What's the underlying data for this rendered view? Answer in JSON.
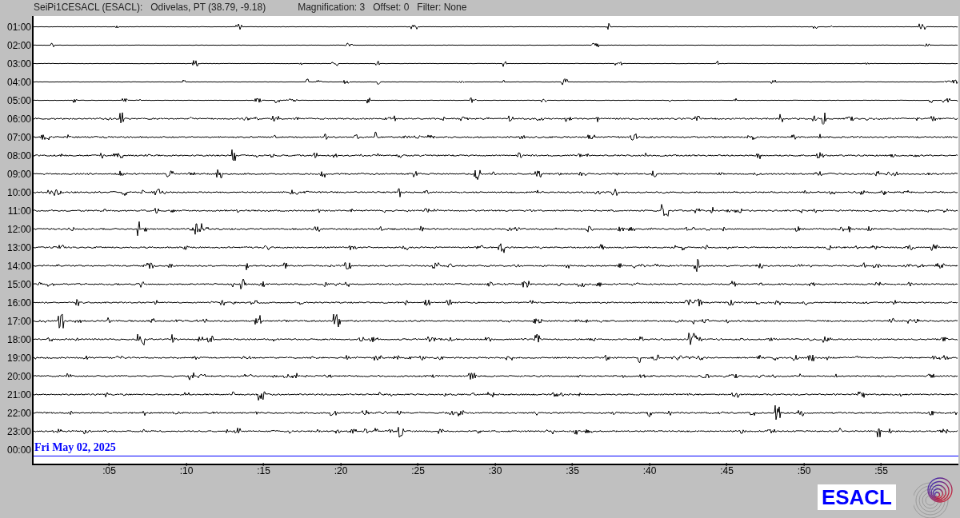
{
  "header": {
    "station": "SeiPi1CESACL (ESACL):",
    "location": "Odivelas, PT (38.79, -9.18)",
    "magnification": "Magnification: 3",
    "offset": "Offset: 0",
    "filter": "Filter: None"
  },
  "rows": [
    {
      "label": "01:00",
      "current": false
    },
    {
      "label": "02:00",
      "current": false
    },
    {
      "label": "03:00",
      "current": false
    },
    {
      "label": "04:00",
      "current": false
    },
    {
      "label": "05:00",
      "current": false
    },
    {
      "label": "06:00",
      "current": false
    },
    {
      "label": "07:00",
      "current": false
    },
    {
      "label": "08:00",
      "current": false
    },
    {
      "label": "09:00",
      "current": false
    },
    {
      "label": "10:00",
      "current": false
    },
    {
      "label": "11:00",
      "current": false
    },
    {
      "label": "12:00",
      "current": false
    },
    {
      "label": "13:00",
      "current": false
    },
    {
      "label": "14:00",
      "current": false
    },
    {
      "label": "15:00",
      "current": false
    },
    {
      "label": "16:00",
      "current": false
    },
    {
      "label": "17:00",
      "current": false
    },
    {
      "label": "18:00",
      "current": false
    },
    {
      "label": "19:00",
      "current": false
    },
    {
      "label": "20:00",
      "current": false
    },
    {
      "label": "21:00",
      "current": false
    },
    {
      "label": "22:00",
      "current": false
    },
    {
      "label": "23:00",
      "current": false
    },
    {
      "label": "00:00",
      "current": true
    }
  ],
  "date": "Fri May 02, 2025",
  "x_axis": {
    "ticks": [
      ":05",
      ":10",
      ":15",
      ":20",
      ":25",
      ":30",
      ":35",
      ":40",
      ":45",
      ":50",
      ":55"
    ]
  },
  "logo": {
    "text": "ESACL"
  }
}
